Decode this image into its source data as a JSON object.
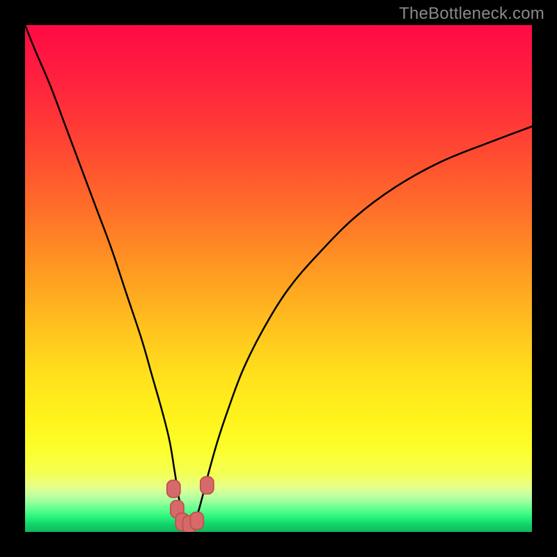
{
  "watermark": "TheBottleneck.com",
  "colors": {
    "frame": "#000000",
    "watermark": "#8a8a8a",
    "curve_stroke": "#000000",
    "marker_fill": "#d66a6a",
    "marker_stroke": "#c24f4f",
    "gradient_stops": [
      {
        "offset": 0.0,
        "color": "#ff0a45"
      },
      {
        "offset": 0.1,
        "color": "#ff1f3f"
      },
      {
        "offset": 0.22,
        "color": "#ff4034"
      },
      {
        "offset": 0.35,
        "color": "#ff6a2a"
      },
      {
        "offset": 0.48,
        "color": "#ff9822"
      },
      {
        "offset": 0.6,
        "color": "#ffc31e"
      },
      {
        "offset": 0.7,
        "color": "#ffe31c"
      },
      {
        "offset": 0.78,
        "color": "#fff41c"
      },
      {
        "offset": 0.84,
        "color": "#fcff2d"
      },
      {
        "offset": 0.885,
        "color": "#f4ff55"
      },
      {
        "offset": 0.905,
        "color": "#eaff7d"
      },
      {
        "offset": 0.918,
        "color": "#d8ff96"
      },
      {
        "offset": 0.93,
        "color": "#baffa0"
      },
      {
        "offset": 0.942,
        "color": "#94ff9a"
      },
      {
        "offset": 0.955,
        "color": "#60ff8e"
      },
      {
        "offset": 0.97,
        "color": "#2cf57e"
      },
      {
        "offset": 0.985,
        "color": "#11d46a"
      },
      {
        "offset": 1.0,
        "color": "#0fb85e"
      }
    ]
  },
  "chart_data": {
    "type": "line",
    "title": "",
    "xlabel": "",
    "ylabel": "",
    "xlim": [
      0,
      100
    ],
    "ylim": [
      0,
      100
    ],
    "grid": false,
    "series": [
      {
        "name": "bottleneck-curve",
        "x": [
          0,
          2,
          5,
          8,
          11,
          14,
          17,
          20,
          23,
          25,
          27,
          28.5,
          29.5,
          30.3,
          31,
          31.7,
          32.3,
          33,
          34,
          35,
          36.3,
          38,
          40,
          43,
          47,
          52,
          58,
          65,
          73,
          82,
          92,
          100
        ],
        "y": [
          100,
          95,
          88,
          80,
          72,
          64,
          56,
          47,
          38,
          31,
          24,
          18,
          12,
          7,
          3.5,
          1.8,
          1.2,
          1.8,
          3.5,
          7,
          12,
          18,
          24,
          32,
          40,
          48,
          55,
          62,
          68,
          73,
          77,
          80
        ]
      }
    ],
    "markers": [
      {
        "name": "marker-left-top",
        "x": 29.3,
        "y": 8.5
      },
      {
        "name": "marker-left-mid",
        "x": 30.0,
        "y": 4.5
      },
      {
        "name": "marker-bottom-1",
        "x": 31.0,
        "y": 2.0
      },
      {
        "name": "marker-bottom-2",
        "x": 32.4,
        "y": 1.5
      },
      {
        "name": "marker-bottom-3",
        "x": 33.9,
        "y": 2.2
      },
      {
        "name": "marker-right-top",
        "x": 35.9,
        "y": 9.2
      }
    ]
  }
}
